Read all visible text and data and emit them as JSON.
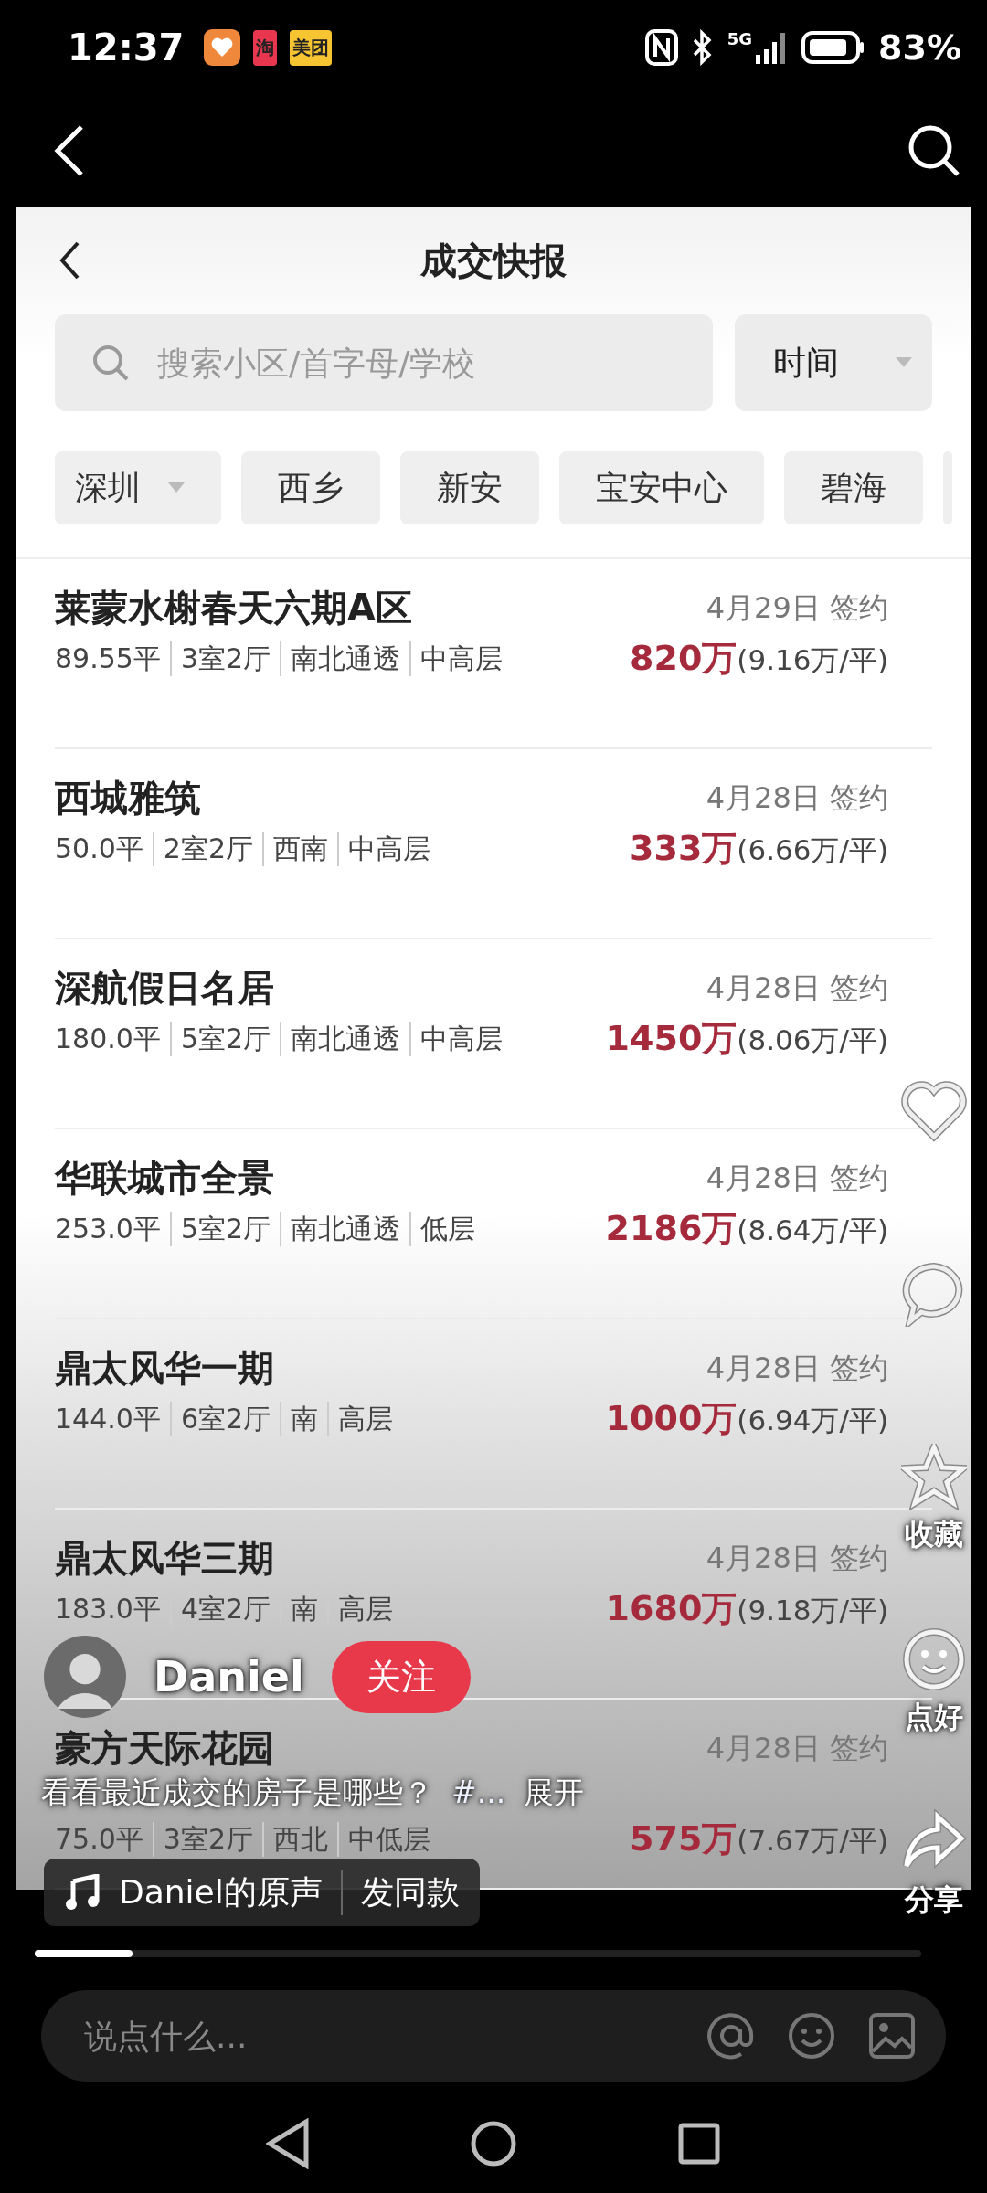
{
  "status_bar": {
    "time": "12:37",
    "network": "5G",
    "battery": "83%",
    "notifications": [
      {
        "kind": "heart"
      },
      {
        "kind": "text",
        "label": "淘",
        "color": "#e8364f"
      },
      {
        "kind": "text",
        "label": "美团",
        "color": "#f7c531"
      }
    ]
  },
  "app_screenshot": {
    "title": "成交快报",
    "search": {
      "placeholder": "搜索小区/首字母/学校"
    },
    "sort": {
      "label": "时间"
    },
    "chips": [
      {
        "label": "深圳",
        "dropdown": true
      },
      {
        "label": "西乡",
        "dropdown": false
      },
      {
        "label": "新安",
        "dropdown": false
      },
      {
        "label": "宝安中心",
        "dropdown": false
      },
      {
        "label": "碧海",
        "dropdown": false
      }
    ],
    "listings": [
      {
        "name": "莱蒙水榭春天六期A区",
        "specs": [
          "89.55平",
          "3室2厅",
          "南北通透",
          "中高层"
        ],
        "date": "4月29日",
        "status": "签约",
        "price": "820万",
        "unit_price": "(9.16万/平)"
      },
      {
        "name": "西城雅筑",
        "specs": [
          "50.0平",
          "2室2厅",
          "西南",
          "中高层"
        ],
        "date": "4月28日",
        "status": "签约",
        "price": "333万",
        "unit_price": "(6.66万/平)"
      },
      {
        "name": "深航假日名居",
        "specs": [
          "180.0平",
          "5室2厅",
          "南北通透",
          "中高层"
        ],
        "date": "4月28日",
        "status": "签约",
        "price": "1450万",
        "unit_price": "(8.06万/平)"
      },
      {
        "name": "华联城市全景",
        "specs": [
          "253.0平",
          "5室2厅",
          "南北通透",
          "低层"
        ],
        "date": "4月28日",
        "status": "签约",
        "price": "2186万",
        "unit_price": "(8.64万/平)"
      },
      {
        "name": "鼎太风华一期",
        "specs": [
          "144.0平",
          "6室2厅",
          "南",
          "高层"
        ],
        "date": "4月28日",
        "status": "签约",
        "price": "1000万",
        "unit_price": "(6.94万/平)"
      },
      {
        "name": "鼎太风华三期",
        "specs": [
          "183.0平",
          "4室2厅",
          "南",
          "高层"
        ],
        "date": "4月28日",
        "status": "签约",
        "price": "1680万",
        "unit_price": "(9.18万/平)"
      },
      {
        "name": "豪方天际花园",
        "specs": [
          "75.0平",
          "3室2厅",
          "西北",
          "中低层"
        ],
        "date": "4月28日",
        "status": "签约",
        "price": "575万",
        "unit_price": "(7.67万/平)"
      }
    ]
  },
  "video_overlay": {
    "author": {
      "name": "Daniel",
      "follow": "关注"
    },
    "caption": {
      "text": "看看最近成交的房子是哪些？",
      "tag": "#...",
      "more": "展开"
    },
    "music": {
      "title": "Daniel的原声",
      "action": "发同款"
    },
    "actions": [
      {
        "kind": "like"
      },
      {
        "kind": "comment"
      },
      {
        "kind": "favorite",
        "label": "收藏"
      },
      {
        "kind": "face",
        "label": "点好"
      },
      {
        "kind": "share",
        "label": "分享"
      }
    ],
    "progress": {
      "level": 0.11
    },
    "comment_box": {
      "placeholder": "说点什么..."
    }
  }
}
